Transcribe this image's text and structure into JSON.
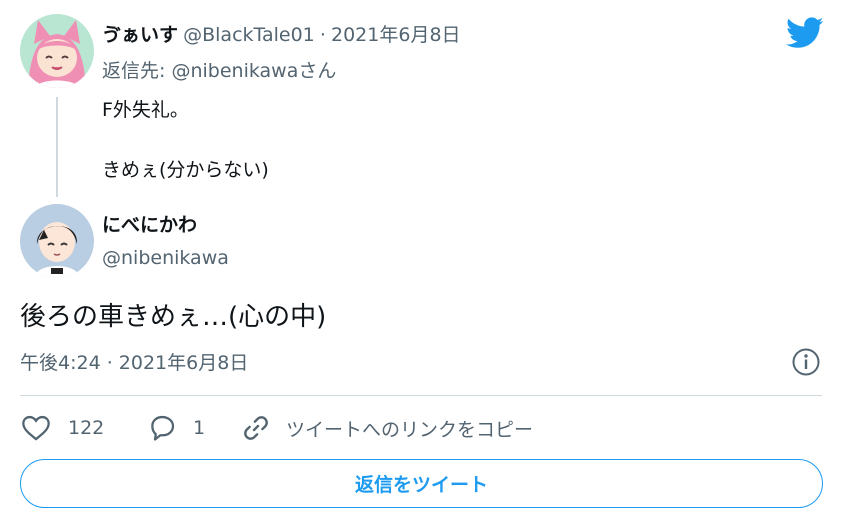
{
  "parent": {
    "display_name": "ゔぁいす",
    "handle": "@BlackTale01",
    "separator": "·",
    "date": "2021年6月8日",
    "reply_to_label": "返信先: ",
    "reply_to_handle": "@nibenikawa",
    "reply_to_suffix": "さん",
    "text_line1": "F外失礼。",
    "text_line2": "きめぇ(分からない)"
  },
  "main": {
    "display_name": "にべにかわ",
    "handle": "@nibenikawa",
    "text": "後ろの車きめぇ…(心の中)",
    "timestamp": "午後4:24 · 2021年6月8日"
  },
  "actions": {
    "like_count": "122",
    "reply_count": "1",
    "copy_link_label": "ツイートへのリンクをコピー"
  },
  "reply_button_label": "返信をツイート",
  "colors": {
    "accent": "#1d9bf0",
    "text": "#0f1419",
    "muted": "#536471",
    "divider": "#cfd9de"
  },
  "icons": [
    "twitter-bird-icon",
    "info-icon",
    "heart-icon",
    "reply-icon",
    "link-icon"
  ]
}
